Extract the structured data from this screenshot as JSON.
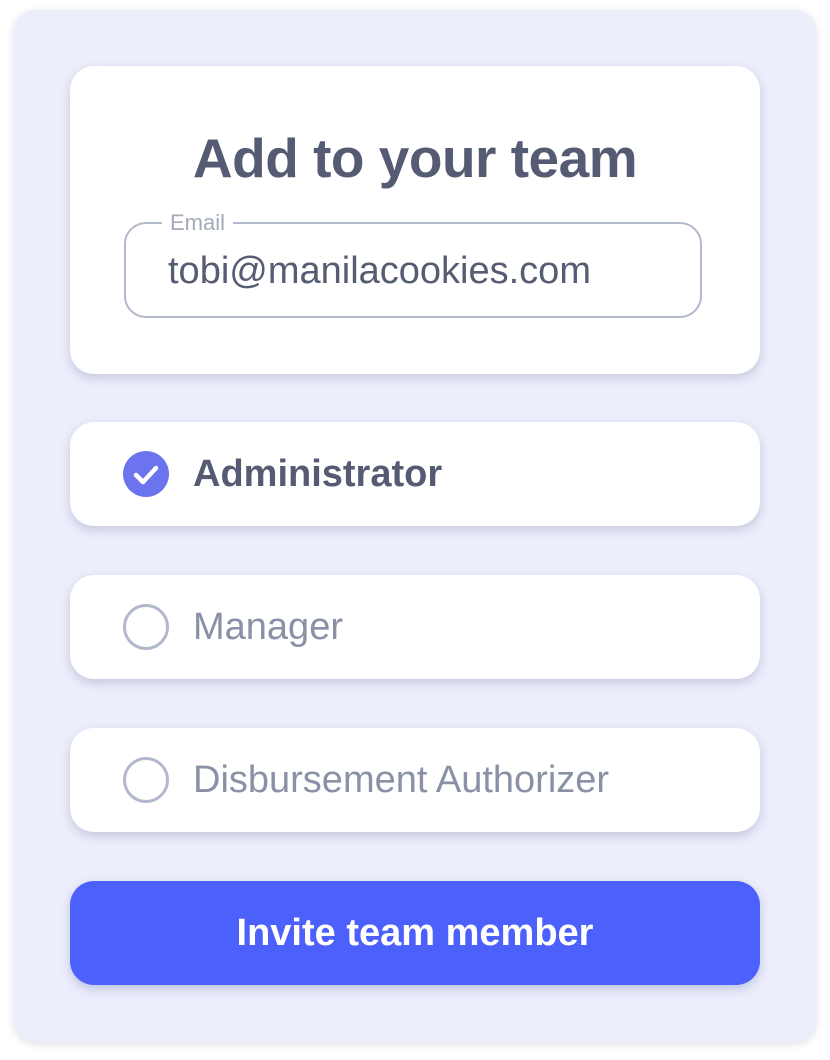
{
  "header": {
    "title": "Add to your team"
  },
  "email": {
    "label": "Email",
    "value": "tobi@manilacookies.com"
  },
  "roles": [
    {
      "label": "Administrator",
      "selected": true
    },
    {
      "label": "Manager",
      "selected": false
    },
    {
      "label": "Disbursement Authorizer",
      "selected": false
    }
  ],
  "invite_button": {
    "label": "Invite team member"
  },
  "colors": {
    "panel_background": "#eceefc",
    "card_background": "#ffffff",
    "accent": "#4c60fb",
    "radio_checked": "#6b74ee",
    "text_dark": "#555b72",
    "text_muted": "#8a91a7",
    "border": "#b3b9cc"
  },
  "icons": {
    "selected_radio": "check-circle-icon",
    "unselected_radio": "empty-circle-icon"
  }
}
